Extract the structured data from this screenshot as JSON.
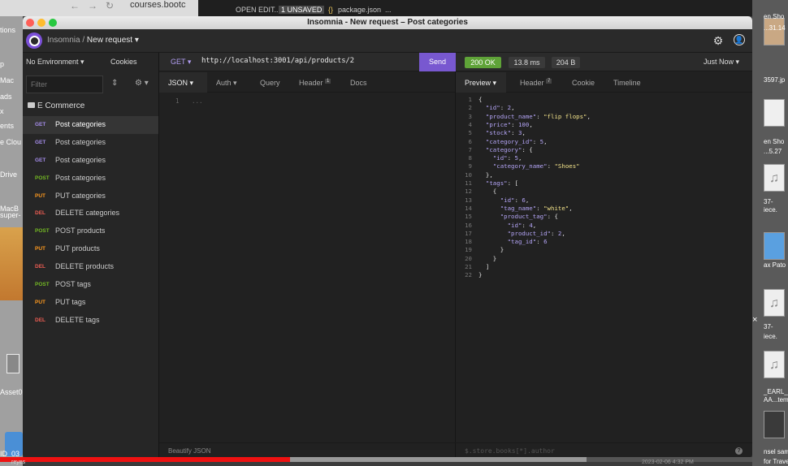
{
  "browser": {
    "url_fragment": "courses.bootc",
    "tab_badge": "1"
  },
  "vscode": {
    "open_editors": "OPEN EDIT...",
    "unsaved": "1 UNSAVED",
    "file": "package.json",
    "more": "..."
  },
  "desktop_left_labels": [
    "tions",
    "p",
    "Mac",
    "ads",
    "x",
    "ents",
    "e Clou",
    "Drive",
    "MacB",
    "super-",
    "Asset0",
    "ID_03"
  ],
  "desktop_right_labels": [
    "en Sho",
    "...31.14",
    "3597.jp",
    "en Sho",
    "...5.27",
    "37-",
    "iece.",
    "ax Pato",
    "37-",
    "iece.",
    "_EARL_",
    "AA...tems",
    "nsel samp",
    "for Travela"
  ],
  "window": {
    "title": "Insomnia - New request – Post categories"
  },
  "appbar": {
    "app": "Insomnia",
    "separator": "/",
    "request": "New request",
    "settings_icon": "gear-icon",
    "account_icon": "user-icon"
  },
  "sidebar": {
    "environment": "No Environment",
    "cookies": "Cookies",
    "filter_placeholder": "Filter",
    "folder": "E Commerce",
    "items": [
      {
        "method": "GET",
        "name": "Post categories",
        "color": "#a48ce9"
      },
      {
        "method": "GET",
        "name": "Post categories",
        "color": "#a48ce9"
      },
      {
        "method": "GET",
        "name": "Post categories",
        "color": "#a48ce9"
      },
      {
        "method": "POST",
        "name": "Post categories",
        "color": "#75ba24"
      },
      {
        "method": "PUT",
        "name": "PUT categories",
        "color": "#ff9a1f"
      },
      {
        "method": "DEL",
        "name": "DELETE categories",
        "color": "#ec5d53"
      },
      {
        "method": "POST",
        "name": "POST products",
        "color": "#75ba24"
      },
      {
        "method": "PUT",
        "name": "PUT products",
        "color": "#ff9a1f"
      },
      {
        "method": "DEL",
        "name": "DELETE products",
        "color": "#ec5d53"
      },
      {
        "method": "POST",
        "name": "POST tags",
        "color": "#75ba24"
      },
      {
        "method": "PUT",
        "name": "PUT tags",
        "color": "#ff9a1f"
      },
      {
        "method": "DEL",
        "name": "DELETE tags",
        "color": "#ec5d53"
      }
    ]
  },
  "request": {
    "method": "GET",
    "url": "http://localhost:3001/api/products/2",
    "send": "Send",
    "tabs": {
      "body": "JSON",
      "auth": "Auth",
      "query": "Query",
      "header": "Header",
      "header_count": "1",
      "docs": "Docs"
    },
    "editor_line": "1",
    "editor_placeholder": "...",
    "footer": "Beautify JSON"
  },
  "response": {
    "status": "200 OK",
    "time": "13.8 ms",
    "size": "204 B",
    "when": "Just Now",
    "tabs": {
      "preview": "Preview",
      "header": "Header",
      "header_count": "7",
      "cookie": "Cookie",
      "timeline": "Timeline"
    },
    "filter_placeholder": "$.store.books[*].author",
    "help": "?",
    "lines": [
      [
        [
          "p",
          "{"
        ]
      ],
      [
        [
          "p",
          "  "
        ],
        [
          "k",
          "\"id\""
        ],
        [
          "p",
          ": "
        ],
        [
          "v",
          "2"
        ],
        [
          "p",
          ","
        ]
      ],
      [
        [
          "p",
          "  "
        ],
        [
          "k",
          "\"product_name\""
        ],
        [
          "p",
          ": "
        ],
        [
          "s",
          "\"flip flops\""
        ],
        [
          "p",
          ","
        ]
      ],
      [
        [
          "p",
          "  "
        ],
        [
          "k",
          "\"price\""
        ],
        [
          "p",
          ": "
        ],
        [
          "v",
          "100"
        ],
        [
          "p",
          ","
        ]
      ],
      [
        [
          "p",
          "  "
        ],
        [
          "k",
          "\"stock\""
        ],
        [
          "p",
          ": "
        ],
        [
          "v",
          "3"
        ],
        [
          "p",
          ","
        ]
      ],
      [
        [
          "p",
          "  "
        ],
        [
          "k",
          "\"category_id\""
        ],
        [
          "p",
          ": "
        ],
        [
          "v",
          "5"
        ],
        [
          "p",
          ","
        ]
      ],
      [
        [
          "p",
          "  "
        ],
        [
          "k",
          "\"category\""
        ],
        [
          "p",
          ": {"
        ]
      ],
      [
        [
          "p",
          "    "
        ],
        [
          "k",
          "\"id\""
        ],
        [
          "p",
          ": "
        ],
        [
          "v",
          "5"
        ],
        [
          "p",
          ","
        ]
      ],
      [
        [
          "p",
          "    "
        ],
        [
          "k",
          "\"category_name\""
        ],
        [
          "p",
          ": "
        ],
        [
          "s",
          "\"Shoes\""
        ]
      ],
      [
        [
          "p",
          "  },"
        ]
      ],
      [
        [
          "p",
          "  "
        ],
        [
          "k",
          "\"tags\""
        ],
        [
          "p",
          ": ["
        ]
      ],
      [
        [
          "p",
          "    {"
        ]
      ],
      [
        [
          "p",
          "      "
        ],
        [
          "k",
          "\"id\""
        ],
        [
          "p",
          ": "
        ],
        [
          "v",
          "6"
        ],
        [
          "p",
          ","
        ]
      ],
      [
        [
          "p",
          "      "
        ],
        [
          "k",
          "\"tag_name\""
        ],
        [
          "p",
          ": "
        ],
        [
          "s",
          "\"white\""
        ],
        [
          "p",
          ","
        ]
      ],
      [
        [
          "p",
          "      "
        ],
        [
          "k",
          "\"product_tag\""
        ],
        [
          "p",
          ": {"
        ]
      ],
      [
        [
          "p",
          "        "
        ],
        [
          "k",
          "\"id\""
        ],
        [
          "p",
          ": "
        ],
        [
          "v",
          "4"
        ],
        [
          "p",
          ","
        ]
      ],
      [
        [
          "p",
          "        "
        ],
        [
          "k",
          "\"product_id\""
        ],
        [
          "p",
          ": "
        ],
        [
          "v",
          "2"
        ],
        [
          "p",
          ","
        ]
      ],
      [
        [
          "p",
          "        "
        ],
        [
          "k",
          "\"tag_id\""
        ],
        [
          "p",
          ": "
        ],
        [
          "v",
          "6"
        ]
      ],
      [
        [
          "p",
          "      }"
        ]
      ],
      [
        [
          "p",
          "    }"
        ]
      ],
      [
        [
          "p",
          "  ]"
        ]
      ],
      [
        [
          "p",
          "}"
        ]
      ]
    ]
  },
  "video": {
    "progress": 0.386,
    "buffered_start": 0.386,
    "buffered_end": 0.78,
    "bottom_left": "reyes",
    "timestamp": "2023-02-06 4:32 PM"
  }
}
